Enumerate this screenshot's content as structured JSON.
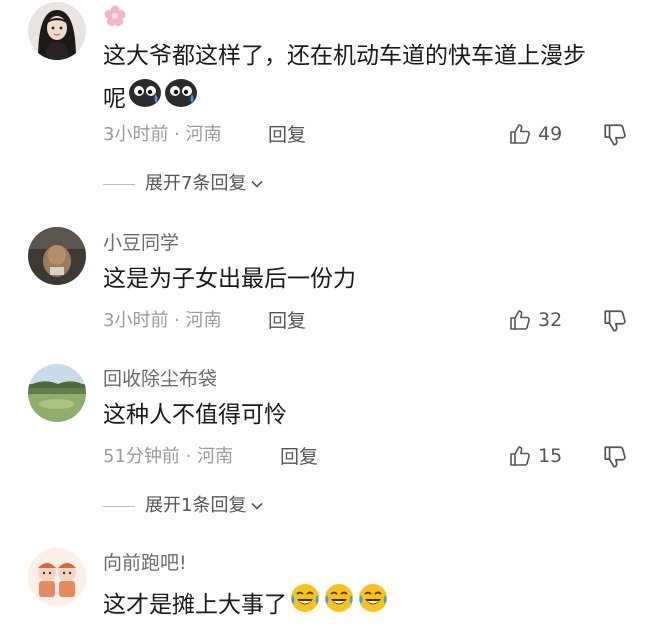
{
  "comments": [
    {
      "username": "",
      "content_lines": [
        "这大爷都这样了，还在机动车道的快车道上漫步",
        "呢"
      ],
      "emojis": [
        "sweat-emoji",
        "sweat-emoji"
      ],
      "time": "3小时前",
      "location": "河南",
      "reply_label": "回复",
      "likes": "49",
      "expand_label": "展开7条回复"
    },
    {
      "username": "小豆同学",
      "content_lines": [
        "这是为子女出最后一份力"
      ],
      "time": "3小时前",
      "location": "河南",
      "reply_label": "回复",
      "likes": "32"
    },
    {
      "username": "回收除尘布袋",
      "content_lines": [
        "这种人不值得可怜"
      ],
      "time": "51分钟前",
      "location": "河南",
      "reply_label": "回复",
      "likes": "15",
      "expand_label": "展开1条回复"
    },
    {
      "username": "向前跑吧!",
      "content_lines": [
        "这才是摊上大事了"
      ],
      "emojis": [
        "laugh-cry-emoji",
        "laugh-cry-emoji",
        "laugh-cry-emoji"
      ]
    }
  ],
  "meta_separator": " · ",
  "colors": {
    "text_primary": "#1a1a1a",
    "text_meta": "#9a9a9a",
    "text_username": "#6a6a6a",
    "emoji_yellow": "#f7c21a",
    "emoji_dark": "#2b2b2b",
    "badge_pink": "#f3b5c4"
  }
}
